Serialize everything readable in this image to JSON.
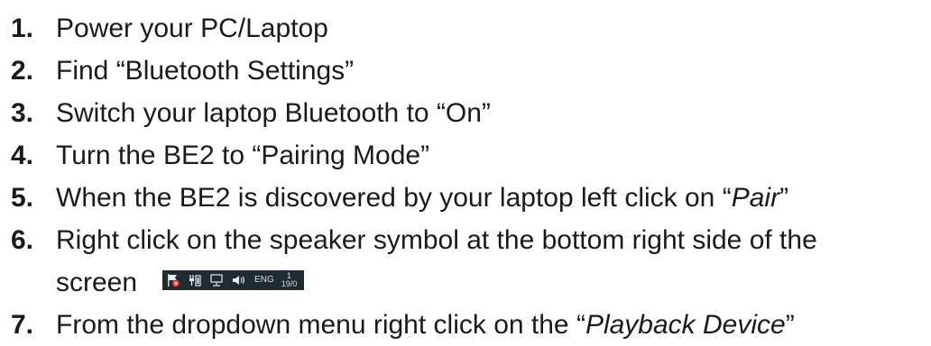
{
  "steps": [
    {
      "num": "1.",
      "text": "Power your PC/Laptop"
    },
    {
      "num": "2.",
      "text": "Find “Bluetooth Settings”"
    },
    {
      "num": "3.",
      "text": "Switch your laptop Bluetooth to “On”"
    },
    {
      "num": "4.",
      "text": "Turn the BE2 to “Pairing Mode”"
    },
    {
      "num": "5.",
      "text_before": "When the BE2 is discovered by your laptop left click on “",
      "text_italic": "Pair",
      "text_after": "”"
    },
    {
      "num": "6.",
      "line1": "Right click on the speaker symbol at the bottom right side of the",
      "line2": "screen"
    },
    {
      "num": "7.",
      "text_before": "From the dropdown menu right click on the “",
      "text_italic": "Playback Device",
      "text_after": "”"
    }
  ],
  "tray": {
    "icons": [
      "flag-error-icon",
      "power-plug-icon",
      "network-icon",
      "speaker-icon"
    ],
    "language": "ENG",
    "clock_top": "1",
    "clock_bottom": "19/0"
  }
}
